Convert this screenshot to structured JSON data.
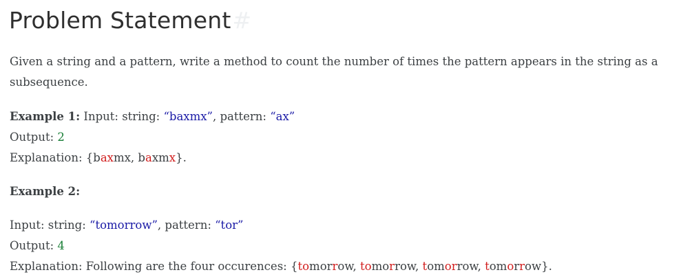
{
  "title": "Problem Statement",
  "title_anchor": "#",
  "description": "Given a string and a pattern, write a method to count the number of times the pattern appears in the string as a subsequence.",
  "example1": {
    "heading": "Example 1:",
    "input_label": " Input: string: ",
    "string": "“baxmx”",
    "pattern_label": ", pattern: ",
    "pattern": "“ax”",
    "output_label": "Output: ",
    "output": "2",
    "explanation_label": "Explanation: ",
    "explanation_segments": [
      {
        "t": "{b",
        "h": false
      },
      {
        "t": "ax",
        "h": true
      },
      {
        "t": "mx, b",
        "h": false
      },
      {
        "t": "a",
        "h": true
      },
      {
        "t": "xm",
        "h": false
      },
      {
        "t": "x",
        "h": true
      },
      {
        "t": "}.",
        "h": false
      }
    ]
  },
  "example2": {
    "heading": "Example 2:",
    "input_label": "Input: string: ",
    "string": "“tomorrow”",
    "pattern_label": ", pattern: ",
    "pattern": "“tor”",
    "output_label": "Output: ",
    "output": "4",
    "explanation_label": "Explanation: Following are the four occurences: ",
    "explanation_segments": [
      {
        "t": "{",
        "h": false
      },
      {
        "t": "to",
        "h": true
      },
      {
        "t": "mor",
        "h": false
      },
      {
        "t": "r",
        "h": true
      },
      {
        "t": "ow, ",
        "h": false
      },
      {
        "t": "to",
        "h": true
      },
      {
        "t": "mo",
        "h": false
      },
      {
        "t": "r",
        "h": true
      },
      {
        "t": "row, ",
        "h": false
      },
      {
        "t": "t",
        "h": true
      },
      {
        "t": "om",
        "h": false
      },
      {
        "t": "or",
        "h": true
      },
      {
        "t": "row, ",
        "h": false
      },
      {
        "t": "t",
        "h": true
      },
      {
        "t": "om",
        "h": false
      },
      {
        "t": "o",
        "h": true
      },
      {
        "t": "r",
        "h": false
      },
      {
        "t": "r",
        "h": true
      },
      {
        "t": "ow}.",
        "h": false
      }
    ]
  }
}
